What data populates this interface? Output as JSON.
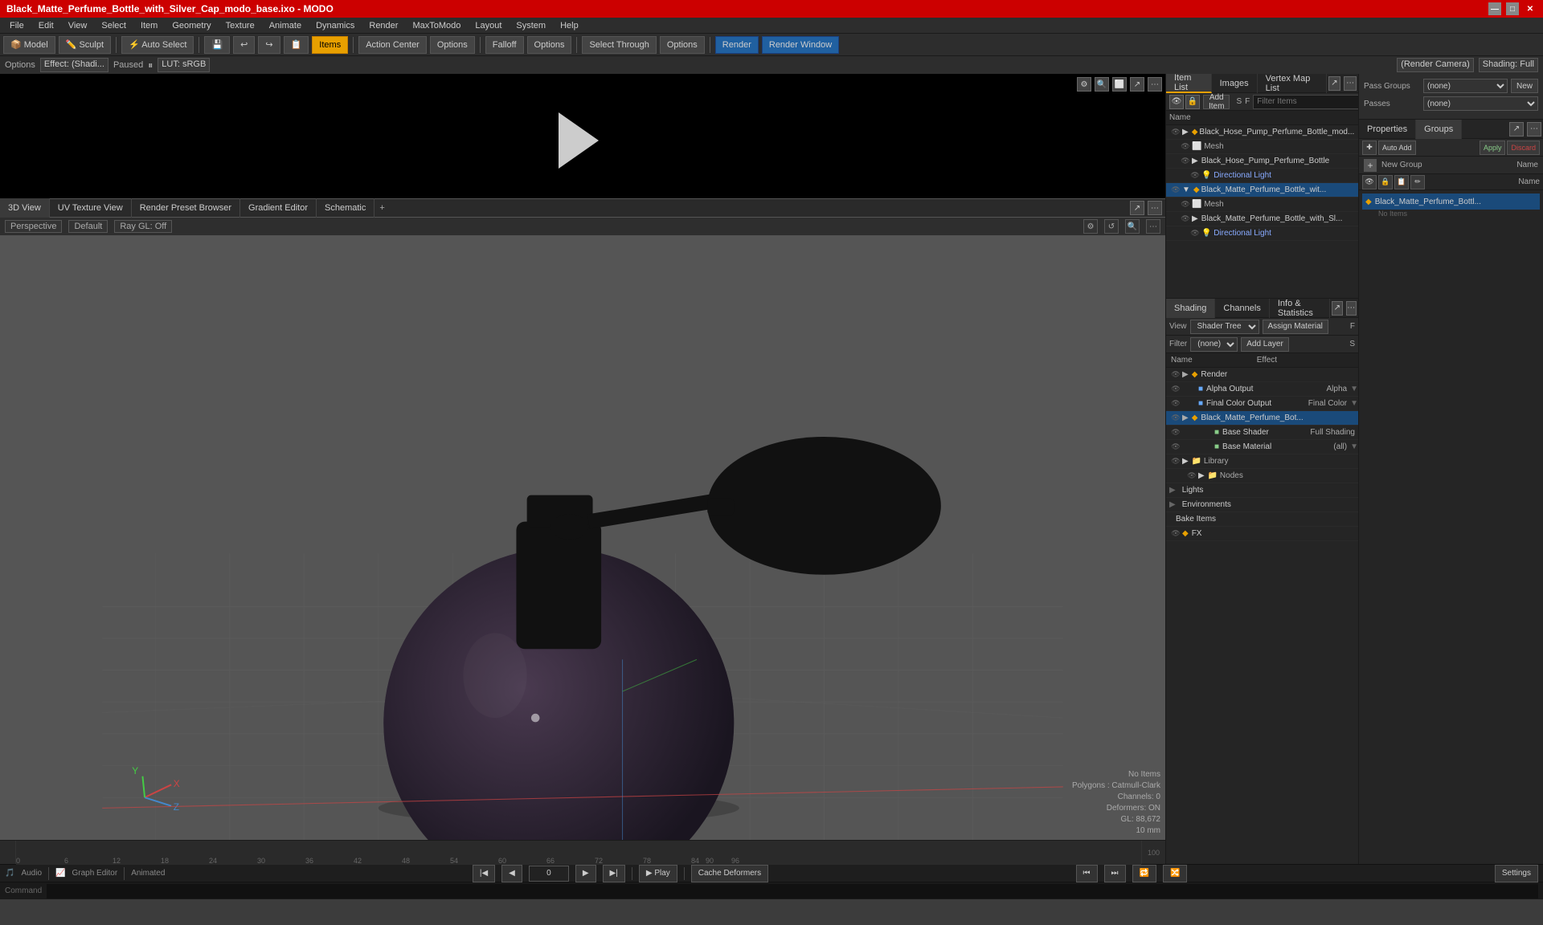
{
  "titlebar": {
    "title": "Black_Matte_Perfume_Bottle_with_Silver_Cap_modo_base.ixo - MODO",
    "winbtns": [
      "—",
      "□",
      "✕"
    ]
  },
  "menubar": {
    "items": [
      "File",
      "Edit",
      "View",
      "Select",
      "Item",
      "Geometry",
      "Texture",
      "Animate",
      "Dynamics",
      "Render",
      "MaxToModo",
      "Layout",
      "System",
      "Help"
    ]
  },
  "toolbar": {
    "mode_btns": [
      "Model",
      "Sculpt"
    ],
    "auto_select": "Auto Select",
    "items_btn": "Items",
    "action_center": "Action Center",
    "options1": "Options",
    "falloff": "Falloff",
    "options2": "Options",
    "select_through": "Select Through",
    "options3": "Options",
    "render": "Render",
    "render_window": "Render Window"
  },
  "mode_tabs": {
    "items": [
      "Model",
      "Sculpt"
    ]
  },
  "effects_bar": {
    "effect_label": "Options",
    "effect_value": "Effect: (Shadi...",
    "status": "Paused",
    "lut": "LUT: sRGB",
    "render_camera": "(Render Camera)",
    "shading": "Shading: Full"
  },
  "viewport_tabs": {
    "items": [
      "3D View",
      "UV Texture View",
      "Render Preset Browser",
      "Gradient Editor",
      "Schematic"
    ],
    "add": "+"
  },
  "viewport": {
    "perspective": "Perspective",
    "default": "Default",
    "ray_gl": "Ray GL: Off",
    "info": {
      "no_items": "No Items",
      "polygons": "Polygons : Catmull-Clark",
      "channels": "Channels: 0",
      "deformers": "Deformers: ON",
      "gl": "GL: 88,672",
      "distance": "10 mm"
    }
  },
  "item_list": {
    "tabs": [
      "Item List",
      "Images",
      "Vertex Map List"
    ],
    "add_item": "Add Item",
    "filter_items": "Filter Items",
    "col_name": "Name",
    "items": [
      {
        "name": "Black_Hose_Pump_Perfume_Bottle_mod...",
        "indent": 0,
        "type": "group",
        "icon": "▶"
      },
      {
        "name": "Mesh",
        "indent": 1,
        "type": "mesh",
        "icon": ""
      },
      {
        "name": "Black_Hose_Pump_Perfume_Bottle",
        "indent": 1,
        "type": "item",
        "icon": "▶"
      },
      {
        "name": "Directional Light",
        "indent": 2,
        "type": "light",
        "icon": ""
      },
      {
        "name": "Black_Matte_Perfume_Bottle_wit...",
        "indent": 0,
        "type": "group",
        "icon": "▼",
        "selected": true
      },
      {
        "name": "Mesh",
        "indent": 1,
        "type": "mesh",
        "icon": ""
      },
      {
        "name": "Black_Matte_Perfume_Bottle_with_Sl...",
        "indent": 1,
        "type": "item",
        "icon": "▶"
      },
      {
        "name": "Directional Light",
        "indent": 2,
        "type": "light",
        "icon": ""
      }
    ]
  },
  "shading": {
    "tabs": [
      "Shading",
      "Channels",
      "Info & Statistics"
    ],
    "view_label": "View",
    "view_value": "Shader Tree",
    "assign_material": "Assign Material",
    "filter_label": "Filter",
    "filter_value": "(none)",
    "add_layer": "Add Layer",
    "col_name": "Name",
    "col_effect": "Effect",
    "rows": [
      {
        "name": "Render",
        "effect": "",
        "indent": 0,
        "type": "render",
        "icon": "◆"
      },
      {
        "name": "Alpha Output",
        "effect": "Alpha",
        "indent": 1,
        "has_arrow": true
      },
      {
        "name": "Final Color Output",
        "effect": "Final Color",
        "indent": 1,
        "has_arrow": true
      },
      {
        "name": "Black_Matte_Perfume_Bot...",
        "effect": "",
        "indent": 1,
        "icon": "◆",
        "selected": true
      },
      {
        "name": "Base Shader",
        "effect": "Full Shading",
        "indent": 2
      },
      {
        "name": "Base Material",
        "effect": "(all)",
        "indent": 2,
        "has_arrow": true
      },
      {
        "name": "Library",
        "effect": "",
        "indent": 1,
        "icon": "▶"
      },
      {
        "name": "Nodes",
        "effect": "",
        "indent": 2,
        "icon": "▶"
      },
      {
        "name": "Lights",
        "effect": "",
        "indent": 0,
        "icon": "▶"
      },
      {
        "name": "Environments",
        "effect": "",
        "indent": 0,
        "icon": "▶"
      },
      {
        "name": "Bake Items",
        "effect": "",
        "indent": 0
      },
      {
        "name": "FX",
        "effect": "",
        "indent": 0,
        "icon": "◆"
      }
    ]
  },
  "pass_groups": {
    "label1": "Pass Groups",
    "select1_value": "(none)",
    "new_btn": "New",
    "label2": "Passes",
    "select2_value": "(none)"
  },
  "properties": {
    "tabs": [
      "Properties",
      "Groups"
    ],
    "new_group": "New Group",
    "name_col": "Name",
    "auto_add": "Auto Add",
    "apply": "Apply",
    "discard": "Discard",
    "groups": [
      {
        "name": "Black_Matte_Perfume_Bottl...",
        "icon": "◆",
        "selected": true
      },
      {
        "name": "No Items",
        "sub": true
      }
    ]
  },
  "timeline": {
    "ticks": [
      "0",
      "6",
      "12",
      "18",
      "24",
      "30",
      "36",
      "42",
      "48",
      "54",
      "60",
      "66",
      "72",
      "78",
      "84",
      "90",
      "96"
    ],
    "current_frame": "0",
    "end_label": "100",
    "end_label2": "100"
  },
  "bottom_statusbar": {
    "audio": "Audio",
    "graph_editor": "Graph Editor",
    "animated": "Animated",
    "frame_value": "0",
    "play": "Play",
    "cache_deformers": "Cache Deformers",
    "settings": "Settings"
  },
  "command_bar": {
    "label": "Command"
  }
}
